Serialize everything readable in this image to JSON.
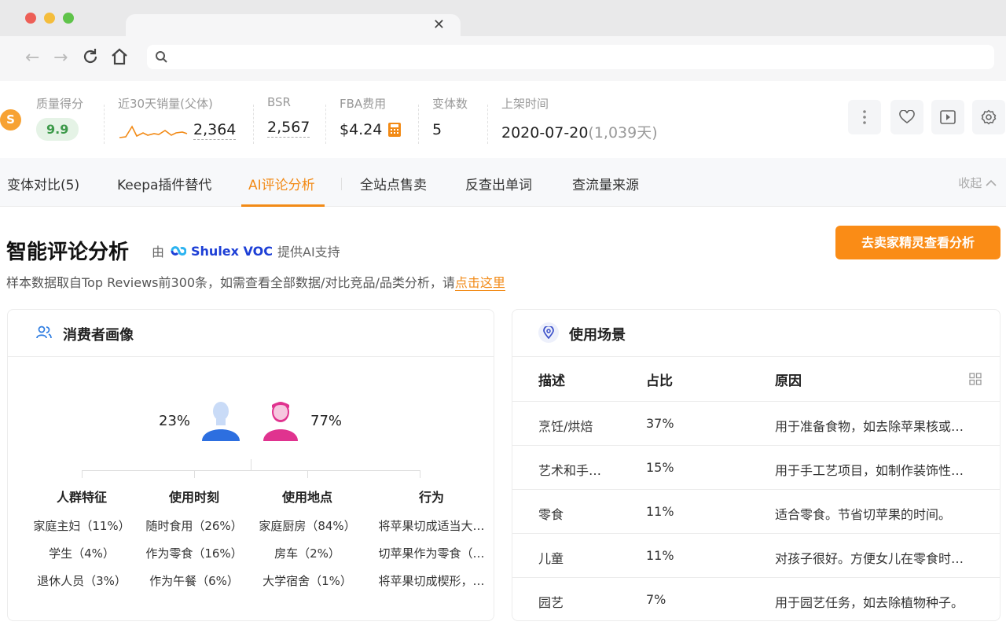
{
  "browser": {
    "close_glyph": "✕",
    "back_glyph": "←",
    "forward_glyph": "→",
    "url": ""
  },
  "stats": {
    "logo_letter": "S",
    "quality": {
      "label": "质量得分",
      "value": "9.9"
    },
    "sales30": {
      "label": "近30天销量(父体)",
      "value": "2,364"
    },
    "bsr": {
      "label": "BSR",
      "value": "2,567"
    },
    "fba": {
      "label": "FBA费用",
      "value": "$4.24"
    },
    "variants": {
      "label": "变体数",
      "value": "5"
    },
    "listed": {
      "label": "上架时间",
      "date": "2020-07-20",
      "days": "(1,039天)"
    }
  },
  "tabs": {
    "items": [
      "变体对比(5)",
      "Keepa插件替代",
      "AI评论分析",
      "全站点售卖",
      "反查出单词",
      "查流量来源"
    ],
    "active_index": 2,
    "collapse_label": "收起"
  },
  "header": {
    "title": "智能评论分析",
    "by_prefix": "由",
    "provider": "Shulex VOC",
    "by_suffix": "提供AI支持",
    "subtitle": "样本数据取自Top Reviews前300条，如需查看全部数据/对比竞品/品类分析，请",
    "link": "点击这里",
    "cta": "去卖家精灵查看分析"
  },
  "consumer": {
    "title": "消费者画像",
    "male_pct": "23%",
    "female_pct": "77%",
    "columns": [
      {
        "title": "人群特征",
        "items": [
          "家庭主妇（11%）",
          "学生（4%）",
          "退休人员（3%）"
        ]
      },
      {
        "title": "使用时刻",
        "items": [
          "随时食用（26%）",
          "作为零食（16%）",
          "作为午餐（6%）"
        ]
      },
      {
        "title": "使用地点",
        "items": [
          "家庭厨房（84%）",
          "房车（2%）",
          "大学宿舍（1%）"
        ]
      },
      {
        "title": "行为",
        "items": [
          "将苹果切成适当大…",
          "切苹果作为零食（…",
          "将苹果切成楔形，…"
        ]
      }
    ]
  },
  "scenes": {
    "title": "使用场景",
    "headers": [
      "描述",
      "占比",
      "原因"
    ],
    "rows": [
      [
        "烹饪/烘焙",
        "37%",
        "用于准备食物，如去除苹果核或…"
      ],
      [
        "艺术和手…",
        "15%",
        "用于手工艺项目，如制作装饰性…"
      ],
      [
        "零食",
        "11%",
        "适合零食。节省切苹果的时间。"
      ],
      [
        "儿童",
        "11%",
        "对孩子很好。方便女儿在零食时…"
      ],
      [
        "园艺",
        "7%",
        "用于园艺任务，如去除植物种子。"
      ]
    ]
  },
  "colors": {
    "accent": "#f28a16",
    "cta": "#fa8c16",
    "male": "#2d6fe0",
    "female": "#e0338f",
    "quality_badge": "#3d9a4a"
  }
}
